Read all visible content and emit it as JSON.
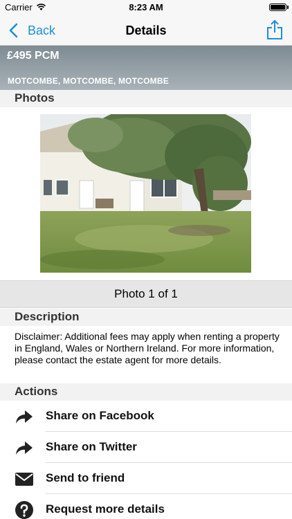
{
  "status_bar": {
    "carrier": "Carrier",
    "time": "8:23 AM"
  },
  "nav": {
    "back_label": "Back",
    "title": "Details"
  },
  "property": {
    "price": "£495 PCM",
    "address": "MOTCOMBE, MOTCOMBE, MOTCOMBE"
  },
  "sections": {
    "photos": "Photos",
    "description": "Description",
    "actions": "Actions"
  },
  "photo_counter": "Photo 1 of 1",
  "description_text": "Disclaimer: Additional fees may apply when renting a property in England, Wales or Northern Ireland. For more information, please contact the estate agent for more details.",
  "actions": [
    {
      "label": "Share on Facebook",
      "icon": "share-arrow-icon"
    },
    {
      "label": "Share on Twitter",
      "icon": "share-arrow-icon"
    },
    {
      "label": "Send to friend",
      "icon": "envelope-icon"
    },
    {
      "label": "Request more details",
      "icon": "question-circle-icon"
    }
  ],
  "colors": {
    "accent": "#1b8fd6",
    "header_gray": "#8e999f"
  }
}
